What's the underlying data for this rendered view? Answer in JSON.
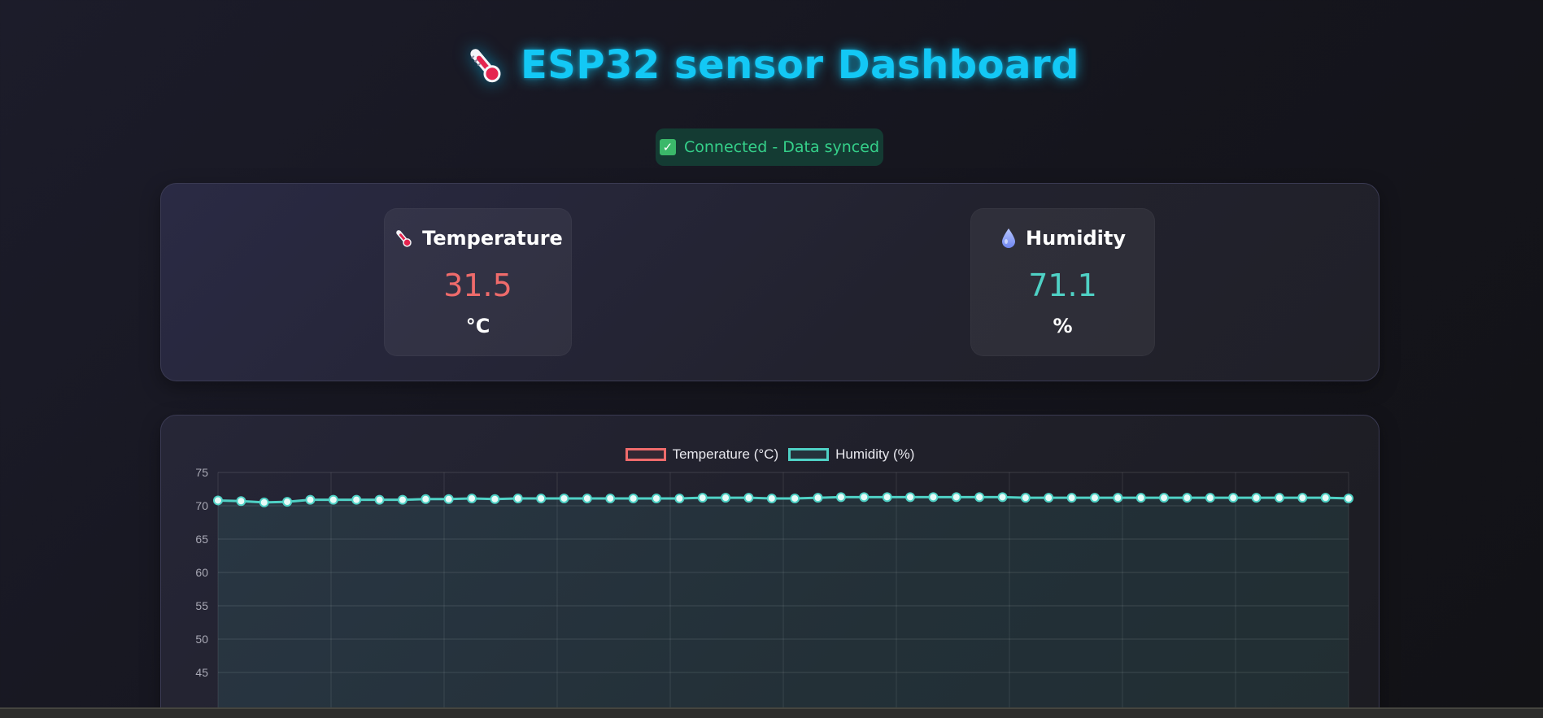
{
  "header": {
    "title": "ESP32 sensor Dashboard",
    "icon": "thermometer-icon"
  },
  "status": {
    "icon": "check-icon",
    "text": "Connected - Data synced",
    "color": "#35d08a"
  },
  "readings": {
    "temperature": {
      "icon": "thermometer-icon",
      "label": "Temperature",
      "value": "31.5",
      "unit": "°C",
      "color": "#ef6b6b"
    },
    "humidity": {
      "icon": "droplet-icon",
      "label": "Humidity",
      "value": "71.1",
      "unit": "%",
      "color": "#4fd1c5"
    }
  },
  "chart_data": {
    "type": "line",
    "legend_position": "top-center",
    "grid": true,
    "ylim": [
      45,
      75
    ],
    "yticks": [
      "75",
      "70",
      "65",
      "60",
      "55",
      "50",
      "45"
    ],
    "series": [
      {
        "name": "Temperature (°C)",
        "color": "#ef6b6b",
        "values": []
      },
      {
        "name": "Humidity (%)",
        "color": "#4fd1c5",
        "values": [
          70.8,
          70.7,
          70.5,
          70.6,
          70.9,
          70.9,
          70.9,
          70.9,
          70.9,
          71.0,
          71.0,
          71.1,
          71.0,
          71.1,
          71.1,
          71.1,
          71.1,
          71.1,
          71.1,
          71.1,
          71.1,
          71.2,
          71.2,
          71.2,
          71.1,
          71.1,
          71.2,
          71.3,
          71.3,
          71.3,
          71.3,
          71.3,
          71.3,
          71.3,
          71.3,
          71.2,
          71.2,
          71.2,
          71.2,
          71.2,
          71.2,
          71.2,
          71.2,
          71.2,
          71.2,
          71.2,
          71.2,
          71.2,
          71.2,
          71.1
        ]
      }
    ]
  }
}
